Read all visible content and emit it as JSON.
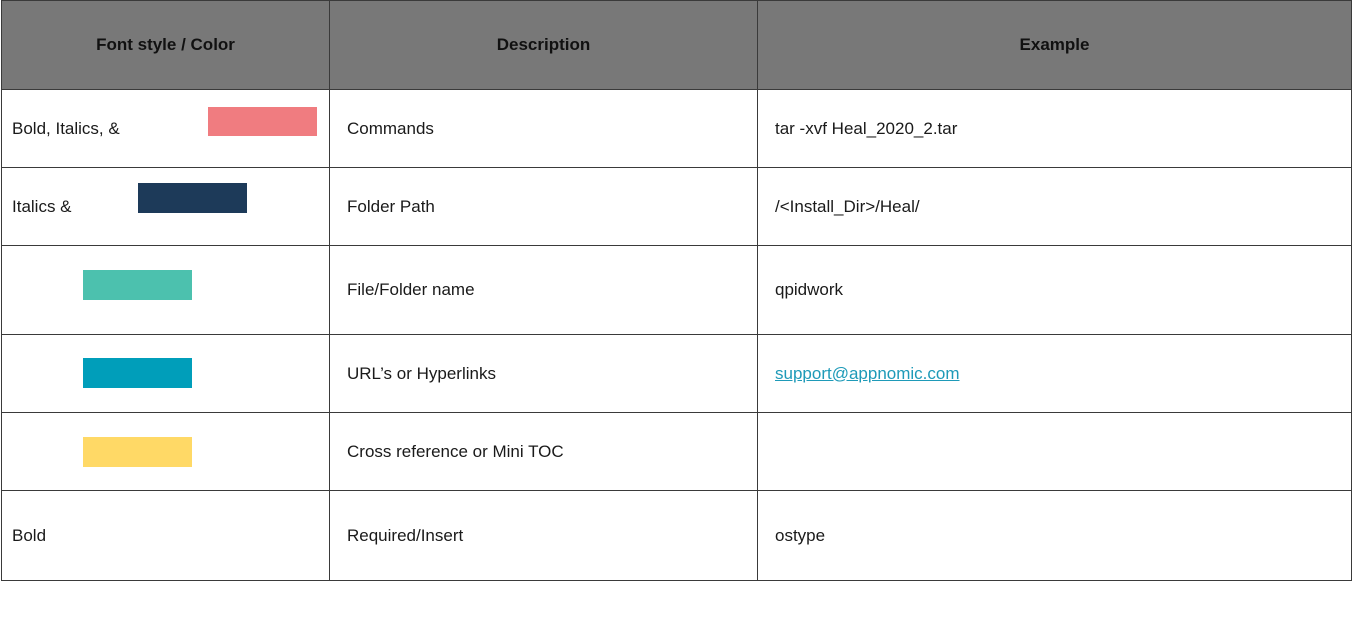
{
  "table": {
    "headers": [
      "Font style / Color",
      "Description",
      "Example"
    ],
    "rows": [
      {
        "style_label": "Bold, Italics, &",
        "swatch_color": "#F07C80",
        "description": "Commands",
        "example": "tar -xvf Heal_2020_2.tar",
        "example_color": "#1a1a1a"
      },
      {
        "style_label": "Italics &",
        "swatch_color": "#1D3A59",
        "description": "Folder Path",
        "example": "/<Install_Dir>/Heal/",
        "example_color": "#1a1a1a"
      },
      {
        "style_label": "",
        "swatch_color": "#4CC1AE",
        "description": "File/Folder name",
        "example": "qpidwork",
        "example_color": "#1a1a1a"
      },
      {
        "style_label": "",
        "swatch_color": "#009EBA",
        "description": "URL’s or Hyperlinks",
        "example": "support@appnomic.com",
        "example_color": "#1E9AB8"
      },
      {
        "style_label": "",
        "swatch_color": "#FFD966",
        "description": "Cross reference or Mini TOC",
        "example": "",
        "example_color": "#1a1a1a"
      },
      {
        "style_label": "Bold",
        "swatch_color": "",
        "description": "Required/Insert",
        "example": "ostype",
        "example_color": "#1a1a1a"
      }
    ]
  }
}
